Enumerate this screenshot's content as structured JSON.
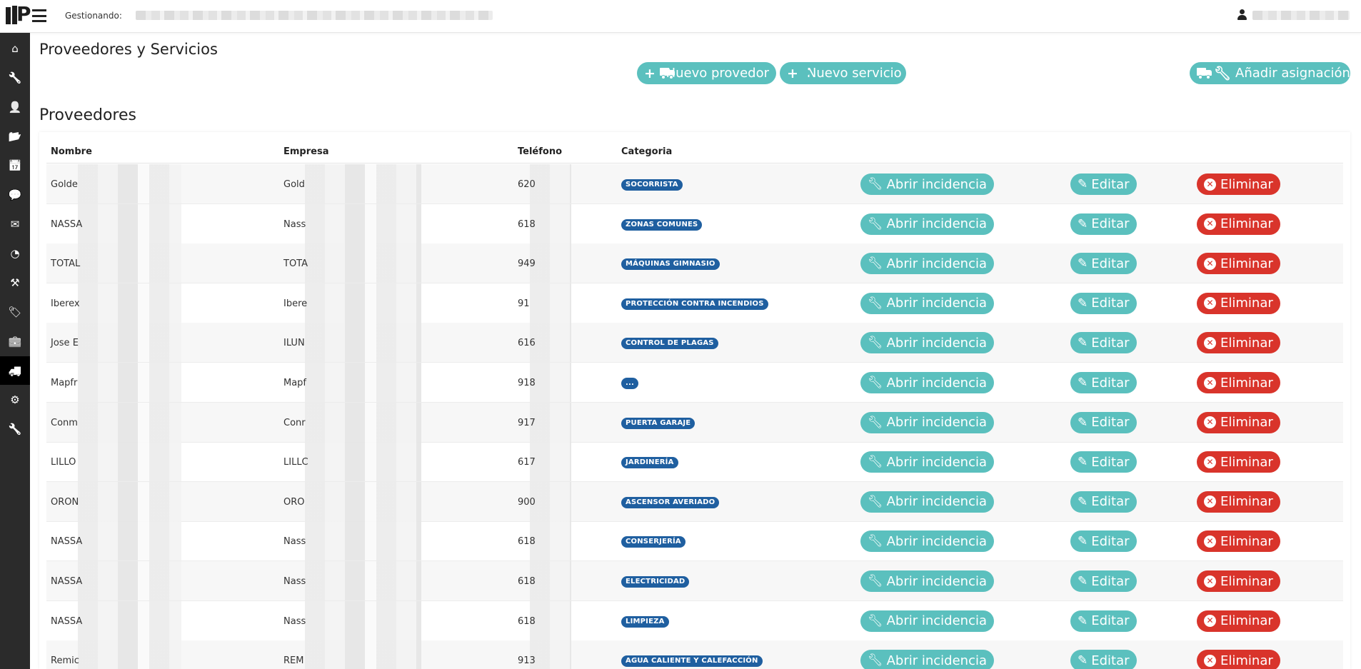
{
  "topbar": {
    "logo_text": "P",
    "gestionando_label": "Gestionando:"
  },
  "sidebar": {
    "items": [
      {
        "icon": "home-icon",
        "glyph": "⌂",
        "active": false
      },
      {
        "icon": "wrench-icon",
        "glyph": "🔧",
        "active": false
      },
      {
        "icon": "user-icon",
        "glyph": "👤",
        "active": false
      },
      {
        "icon": "folder-open-icon",
        "glyph": "📂",
        "active": false
      },
      {
        "icon": "calendar-icon",
        "glyph": "📅",
        "active": false
      },
      {
        "icon": "comments-icon",
        "glyph": "💬",
        "active": false
      },
      {
        "icon": "envelope-icon",
        "glyph": "✉",
        "active": false
      },
      {
        "icon": "pie-chart-icon",
        "glyph": "◔",
        "active": false
      },
      {
        "icon": "gavel-icon",
        "glyph": "⚒",
        "active": false
      },
      {
        "icon": "tags-icon",
        "glyph": "🏷",
        "active": false
      },
      {
        "icon": "briefcase-icon",
        "glyph": "💼",
        "active": false
      },
      {
        "icon": "truck-icon",
        "glyph": "🚚",
        "active": true
      },
      {
        "icon": "cogs-icon",
        "glyph": "⚙",
        "active": false
      },
      {
        "icon": "wrench-alt-icon",
        "glyph": "🔧",
        "active": false
      }
    ]
  },
  "header": {
    "title": "Proveedores y Servicios",
    "new_provider_label": "Nuevo provedor",
    "new_service_label": "Nuevo servicio",
    "add_assignment_label": "Añadir asignación"
  },
  "providers": {
    "section_title": "Proveedores",
    "columns": {
      "name": "Nombre",
      "company": "Empresa",
      "phone": "Teléfono",
      "category": "Categoria"
    },
    "actions": {
      "open": "Abrir incidencia",
      "edit": "Editar",
      "delete": "Eliminar"
    },
    "rows": [
      {
        "name": "Golde",
        "company": "Gold",
        "phone": "620",
        "category": "SOCORRISTA"
      },
      {
        "name": "NASSA",
        "company": "Nass",
        "phone": "618",
        "category": "ZONAS COMUNES"
      },
      {
        "name": "TOTAL",
        "company": "TOTA",
        "phone": "949",
        "category": "MÁQUINAS GIMNASIO"
      },
      {
        "name": "Iberex",
        "company": "Ibere",
        "phone": "91",
        "category": "PROTECCIÓN CONTRA INCENDIOS"
      },
      {
        "name": "Jose E",
        "company": "ILUN",
        "phone": "616",
        "category": "CONTROL DE PLAGAS"
      },
      {
        "name": "Mapfr",
        "company": "Mapf",
        "phone": "918",
        "category": "..."
      },
      {
        "name": "Conm",
        "company": "Conr",
        "phone": "917",
        "category": "PUERTA GARAJE"
      },
      {
        "name": "LILLO",
        "company": "LILLC",
        "phone": "617",
        "category": "JARDINERÍA"
      },
      {
        "name": "ORON",
        "company": "ORO",
        "phone": "900",
        "category": "ASCENSOR AVERIADO"
      },
      {
        "name": "NASSA",
        "company": "Nass",
        "phone": "618",
        "category": "CONSERJERÍA"
      },
      {
        "name": "NASSA",
        "company": "Nass",
        "phone": "618",
        "category": "ELECTRICIDAD"
      },
      {
        "name": "NASSA",
        "company": "Nass",
        "phone": "618",
        "category": "LIMPIEZA"
      },
      {
        "name": "Remic",
        "company": "REM",
        "phone": "913",
        "category": "AGUA CALIENTE Y CALEFACCIÓN"
      }
    ]
  }
}
